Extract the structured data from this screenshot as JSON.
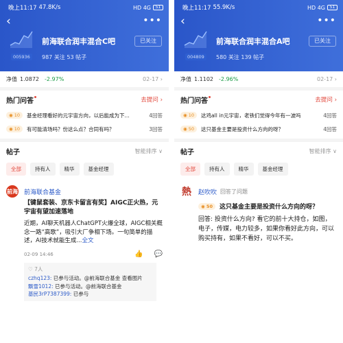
{
  "left": {
    "status": {
      "time": "晚上11:17",
      "net": "47.8K/s",
      "right": "HD 4G ",
      "batt": "51"
    },
    "fund_code": "005936",
    "title": "前海联合润丰混合C吧",
    "follow_label": "已关注",
    "stats": "987 关注  53 帖子",
    "nav": {
      "label": "净值",
      "value": "1.0872",
      "change": "-2.97%",
      "date": "02-17 ›"
    },
    "qa_section": {
      "title": "热门问答",
      "ask": "去提问 ›"
    },
    "qa": [
      {
        "badge": "◉ 10",
        "text": "基金经理看好的元宇宙方向，以后能成为下...",
        "count": "4回答"
      },
      {
        "badge": "◉ 10",
        "text": "有可能清场吗？份这么点？合同有吗？",
        "count": "3回答"
      }
    ],
    "posts_section": {
      "title": "帖子",
      "sort": "智能排序 ∨"
    },
    "filters": [
      "全部",
      "持有人",
      "精华",
      "基金经理"
    ],
    "post": {
      "avatar": "前海",
      "author": "前海联合基金",
      "headline": "【键鼠套装、京东卡留言有奖】AIGC正火热，元宇宙有望加速落地",
      "body": "近期，AI聊天机器人ChatGPT火爆全球，AIGC相关概念一路“高歌”，吸引大厂争相下场。一句简单的描述，AI技术就能生成...",
      "full": "全文",
      "date": "02-09 14:46",
      "likes": "♡ 7人",
      "replies": [
        {
          "user": "czhq123:",
          "text": " 已参与活动。@前海联合基金 查看图片"
        },
        {
          "user": "飘雪1012:",
          "text": " 已参与活动。@前海联合基金"
        },
        {
          "user": "基民3rP7387399:",
          "text": " 已参与"
        }
      ]
    }
  },
  "right": {
    "status": {
      "time": "晚上11:17",
      "net": "55.9K/s",
      "right": "HD 4G ",
      "batt": "51"
    },
    "fund_code": "004809",
    "title": "前海联合润丰混合A吧",
    "follow_label": "已关注",
    "stats": "580 关注  139 帖子",
    "nav": {
      "label": "净值",
      "value": "1.1102",
      "change": "-2.96%",
      "date": "02-17 ›"
    },
    "qa_section": {
      "title": "热门问答",
      "ask": "去提问 ›"
    },
    "qa": [
      {
        "badge": "◉ 10",
        "text": "这鸡all in元宇宙，老铁们觉得今年有一波吗",
        "count": "4回答"
      },
      {
        "badge": "◉ 50",
        "text": "这只基金主要是投资什么方向的呀？",
        "count": "4回答"
      }
    ],
    "posts_section": {
      "title": "帖子",
      "sort": "智能排序 ∨"
    },
    "filters": [
      "全部",
      "持有人",
      "精华",
      "基金经理"
    ],
    "post": {
      "avatar": "熱",
      "author": "赵吹吹",
      "answered": "回答了问题",
      "badge": "◉ 50",
      "question": "这只基金主要是投资什么方向的呀？",
      "body": "回答: 投资什么方向? 看它的前十大持仓，如图，电子，传媒，电力较多，如果你看好此方向，可以购买持有，如果不看好，可以不买。"
    },
    "accent": "#e2483c",
    "link": "#2e5cc9"
  }
}
